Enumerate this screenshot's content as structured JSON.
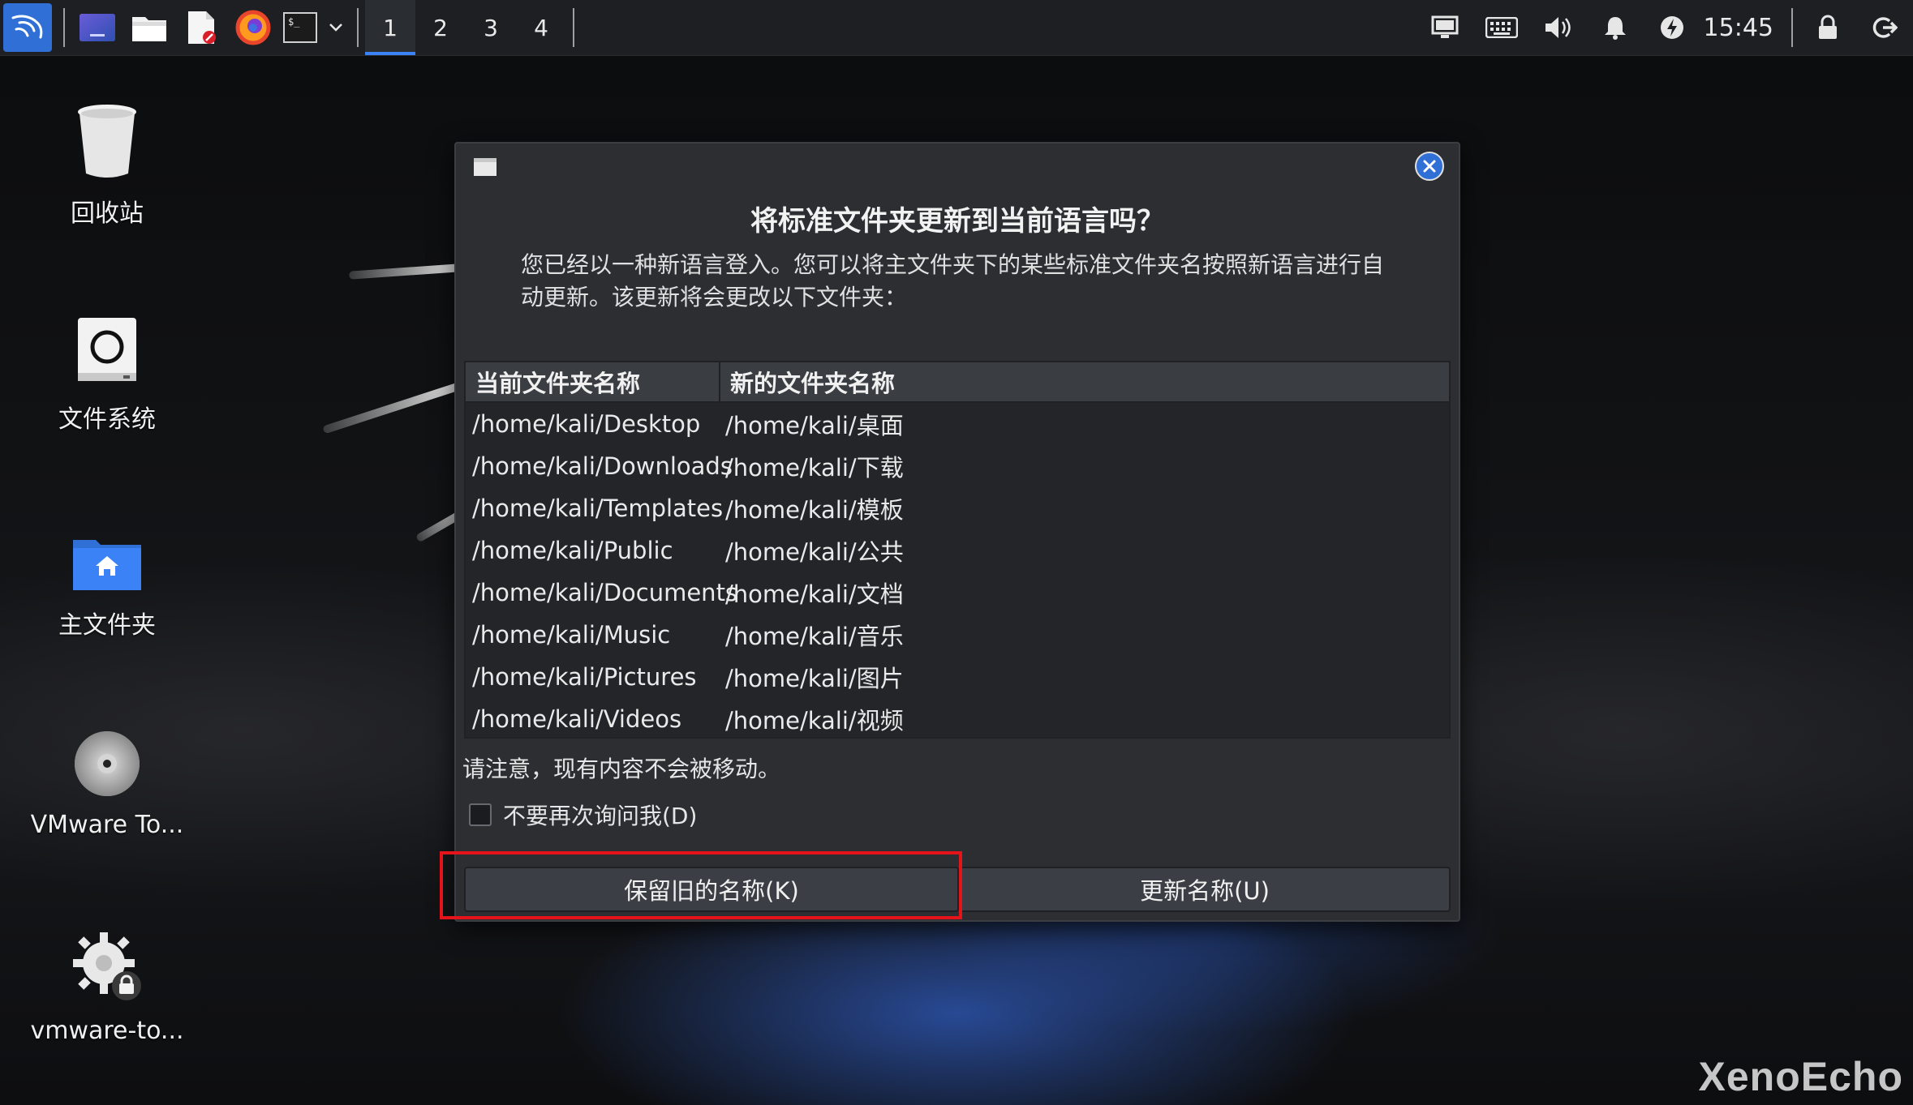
{
  "taskbar": {
    "workspaces": [
      "1",
      "2",
      "3",
      "4"
    ],
    "active_workspace": "1",
    "clock": "15:45",
    "app_icons": [
      "kali-menu-icon",
      "desktop-show-icon",
      "file-manager-icon",
      "text-editor-icon",
      "firefox-icon",
      "terminal-icon",
      "dropdown-chevron-icon"
    ],
    "tray_icons": [
      "display-icon",
      "keyboard-icon",
      "volume-icon",
      "notification-bell-icon",
      "power-manager-icon",
      "lock-icon",
      "logout-icon"
    ]
  },
  "desktop": {
    "icons": [
      {
        "label": "回收站",
        "icon": "trash-icon"
      },
      {
        "label": "文件系统",
        "icon": "filesystem-icon"
      },
      {
        "label": "主文件夹",
        "icon": "home-folder-icon"
      },
      {
        "label": "VMware To...",
        "icon": "cdrom-icon"
      },
      {
        "label": "vmware-to...",
        "icon": "gear-lock-icon"
      }
    ]
  },
  "dialog": {
    "title": "将标准文件夹更新到当前语言吗？",
    "description": "您已经以一种新语言登入。您可以将主文件夹下的某些标准文件夹名按照新语言进行自动更新。该更新将会更改以下文件夹：",
    "table": {
      "headers": [
        "当前文件夹名称",
        "新的文件夹名称"
      ],
      "rows": [
        [
          "/home/kali/Desktop",
          "/home/kali/桌面"
        ],
        [
          "/home/kali/Downloads",
          "/home/kali/下载"
        ],
        [
          "/home/kali/Templates",
          "/home/kali/模板"
        ],
        [
          "/home/kali/Public",
          "/home/kali/公共"
        ],
        [
          "/home/kali/Documents",
          "/home/kali/文档"
        ],
        [
          "/home/kali/Music",
          "/home/kali/音乐"
        ],
        [
          "/home/kali/Pictures",
          "/home/kali/图片"
        ],
        [
          "/home/kali/Videos",
          "/home/kali/视频"
        ]
      ]
    },
    "note": "请注意，现有内容不会被移动。",
    "checkbox_label": "不要再次询问我(D)",
    "checkbox_checked": false,
    "keep_button": "保留旧的名称(K)",
    "update_button": "更新名称(U)"
  },
  "watermark": "XenoEcho",
  "colors": {
    "accent": "#2f6fd6",
    "highlight": "#e5141b",
    "dialog_bg": "#2c2e32"
  }
}
